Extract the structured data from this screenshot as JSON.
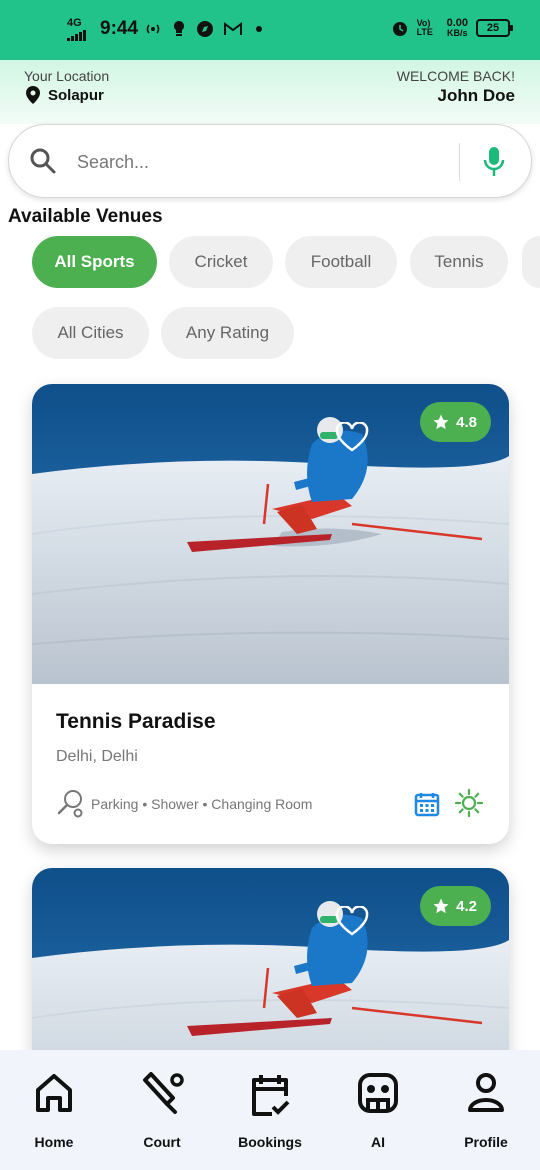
{
  "status_bar": {
    "network": "4G",
    "time": "9:44",
    "volte": "Vo) LTE",
    "speed": "0.00",
    "speed_unit": "KB/s",
    "battery": "25"
  },
  "header": {
    "location_label": "Your Location",
    "location_value": "Solapur",
    "welcome_label": "WELCOME BACK!",
    "user_name": "John Doe"
  },
  "search": {
    "placeholder": "Search...",
    "value": ""
  },
  "section_title": "Available Venues",
  "sport_filters": [
    "All Sports",
    "Cricket",
    "Football",
    "Tennis"
  ],
  "active_sport": "All Sports",
  "other_filters": [
    "All Cities",
    "Any Rating"
  ],
  "venues": [
    {
      "name": "Tennis Paradise",
      "location": "Delhi, Delhi",
      "rating": "4.8",
      "amenities": "Parking • Shower • Changing Room"
    },
    {
      "name": "",
      "location": "",
      "rating": "4.2",
      "amenities": ""
    }
  ],
  "bottom_nav": {
    "items": [
      {
        "label": "Home",
        "icon": "home-icon"
      },
      {
        "label": "Court",
        "icon": "court-icon"
      },
      {
        "label": "Bookings",
        "icon": "calendar-check-icon"
      },
      {
        "label": "AI",
        "icon": "robot-icon"
      },
      {
        "label": "Profile",
        "icon": "person-icon"
      }
    ]
  },
  "colors": {
    "status_bar": "#22c38b",
    "accent_green": "#4caf50",
    "mic_green": "#1db97a",
    "calendar_blue": "#1e88e5"
  }
}
